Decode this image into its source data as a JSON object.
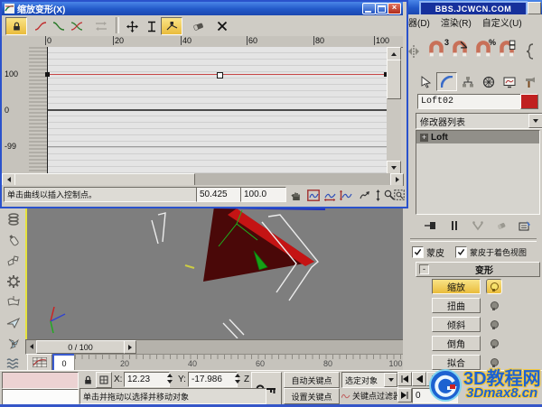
{
  "icons": {
    "close_glyph": "×",
    "plus_glyph": "+",
    "minus_glyph": "-"
  },
  "dialog": {
    "title": "缩放变形(X)",
    "ruler": [
      "0",
      "20",
      "40",
      "60",
      "80",
      "100"
    ],
    "y_axis": [
      "100",
      "0",
      "-99"
    ],
    "prompt": "单击曲线以插入控制点。",
    "point_x": "50.425",
    "point_y": "100.0",
    "curve_data": {
      "type": "line",
      "x_range": [
        0,
        100
      ],
      "y_range": [
        -99,
        100
      ],
      "color": "#c74848",
      "points": [
        {
          "x": 0,
          "y": 100,
          "selected": false
        },
        {
          "x": 50.425,
          "y": 100,
          "selected": true
        },
        {
          "x": 100,
          "y": 100,
          "selected": false
        }
      ]
    }
  },
  "app": {
    "titlebar_text": "BBS.JCWCN.COM",
    "menu": [
      "器(D)",
      "渲染(R)",
      "自定义(U)"
    ],
    "snap_3d_label": "3",
    "snap_percent_label": "%",
    "object_name": "Loft02",
    "modifier_list_label": "修改器列表",
    "stack_item": "Loft",
    "skin_label": "蒙皮",
    "skin_shaded_label": "蒙皮于着色视图",
    "rollout_title": "变形",
    "deform": [
      {
        "label": "缩放",
        "light_on": true
      },
      {
        "label": "扭曲",
        "light_on": false
      },
      {
        "label": "倾斜",
        "light_on": false
      },
      {
        "label": "倒角",
        "light_on": false
      },
      {
        "label": "拟合",
        "light_on": false
      }
    ]
  },
  "timeline": {
    "slider": "0 / 100",
    "frame_cell": "0",
    "ticks": [
      "20",
      "40",
      "60",
      "80",
      "100"
    ]
  },
  "status": {
    "x_label": "X:",
    "x_value": "12.23",
    "y_label": "Y:",
    "y_value": "-17.986",
    "z_label": "Z",
    "prompt": "单击并拖动以选择并移动对象",
    "auto_key": "自动关键点",
    "set_key": "设置关键点",
    "selection_filter": "选定对象",
    "key_filters": "关键点过滤器...",
    "frame_value": "0"
  },
  "watermark": {
    "line1": "3D教程网",
    "line2": "3Dmax8.cn"
  }
}
